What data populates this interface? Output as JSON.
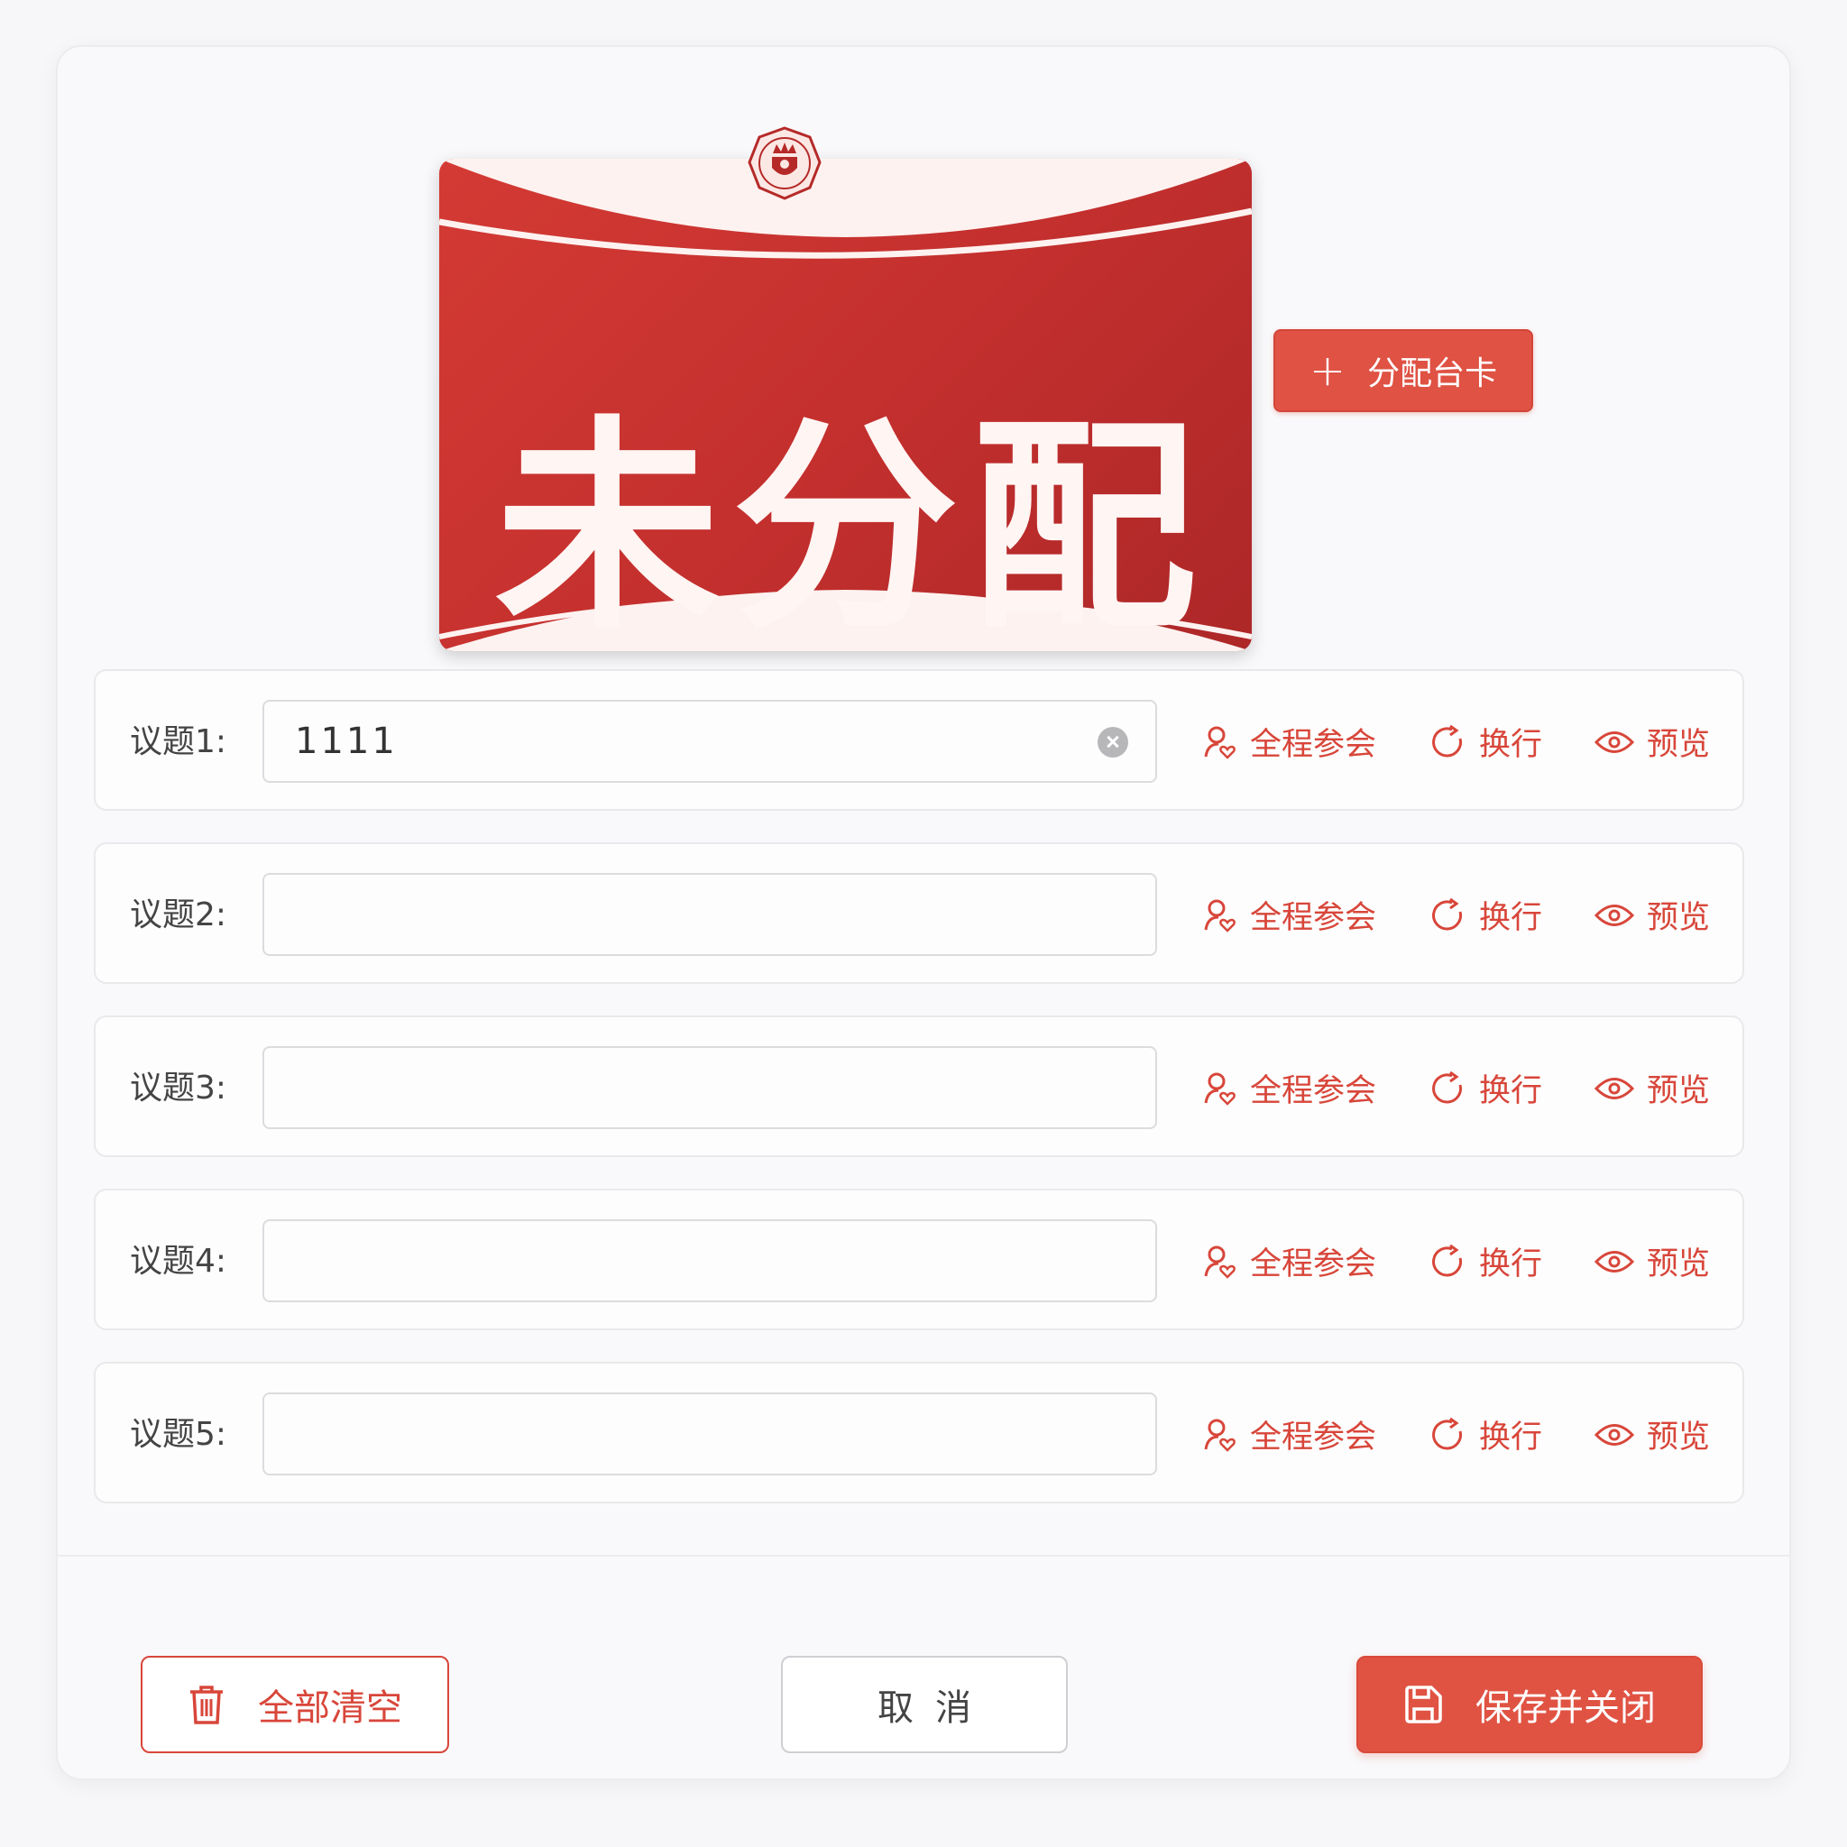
{
  "card": {
    "title": "未分配"
  },
  "assign_button": {
    "icon": "plus-icon",
    "label": "分配台卡"
  },
  "topics": [
    {
      "label": "议题1:",
      "value": "1111",
      "has_clear": true
    },
    {
      "label": "议题2:",
      "value": "",
      "has_clear": false
    },
    {
      "label": "议题3:",
      "value": "",
      "has_clear": false
    },
    {
      "label": "议题4:",
      "value": "",
      "has_clear": false
    },
    {
      "label": "议题5:",
      "value": "",
      "has_clear": false
    }
  ],
  "row_actions": {
    "attend_all": "全程参会",
    "line_break": "换行",
    "preview": "预览"
  },
  "footer": {
    "clear_all": "全部清空",
    "cancel": "取消",
    "save_close": "保存并关闭"
  },
  "colors": {
    "accent": "#d8463a",
    "card_red": "#c4302e"
  }
}
